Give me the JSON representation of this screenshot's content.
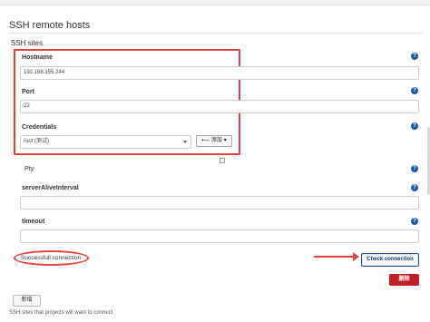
{
  "section": {
    "title": "SSH remote hosts",
    "subheader": "SSH sites"
  },
  "fields": {
    "hostname": {
      "label": "Hostname",
      "value": "192.168.155.244"
    },
    "port": {
      "label": "Port",
      "value": "22"
    },
    "credentials": {
      "label": "Credentials",
      "value": "root (测试)"
    },
    "pty": {
      "label": "Pty"
    },
    "server_alive_interval": {
      "label": "serverAliveInterval",
      "value": ""
    },
    "timeout": {
      "label": "timeout",
      "value": ""
    }
  },
  "buttons": {
    "add": "添加",
    "check_connection": "Check connection",
    "delete": "删除",
    "new": "新增"
  },
  "status": {
    "connection_message": "Successfull connection"
  },
  "footer": {
    "text": "SSH sites that projects will want to connect"
  },
  "icons": {
    "help": "help-icon",
    "add": "key-icon",
    "arrow": "arrow-right-icon"
  },
  "colors": {
    "highlight_red": "#e44141",
    "help_blue": "#1c5aa6",
    "delete_red": "#c21f24",
    "check_blue": "#163a70"
  }
}
